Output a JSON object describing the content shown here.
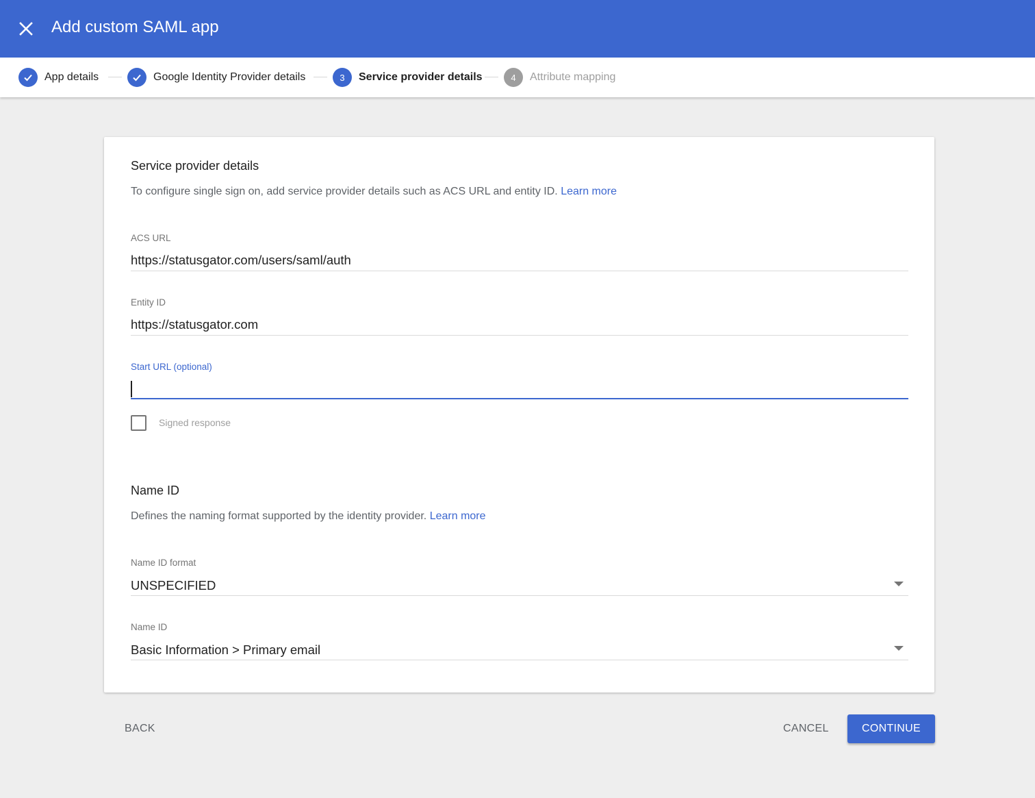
{
  "header": {
    "title": "Add custom SAML app",
    "close_icon": "close-icon"
  },
  "stepper": {
    "steps": [
      {
        "label": "App details",
        "state": "done",
        "number": "1"
      },
      {
        "label": "Google Identity Provider details",
        "state": "done",
        "number": "2"
      },
      {
        "label": "Service provider details",
        "state": "active",
        "number": "3"
      },
      {
        "label": "Attribute mapping",
        "state": "pending",
        "number": "4"
      }
    ]
  },
  "service_provider": {
    "title": "Service provider details",
    "description": "To configure single sign on, add service provider details such as ACS URL and entity ID.",
    "learn_more": "Learn more",
    "acs_url": {
      "label": "ACS URL",
      "value": "https://statusgator.com/users/saml/auth"
    },
    "entity_id": {
      "label": "Entity ID",
      "value": "https://statusgator.com"
    },
    "start_url": {
      "label": "Start URL (optional)",
      "value": ""
    },
    "signed_response": {
      "label": "Signed response",
      "checked": false
    }
  },
  "name_id": {
    "title": "Name ID",
    "description": "Defines the naming format supported by the identity provider.",
    "learn_more": "Learn more",
    "format": {
      "label": "Name ID format",
      "value": "UNSPECIFIED"
    },
    "name_id": {
      "label": "Name ID",
      "value": "Basic Information > Primary email"
    }
  },
  "footer": {
    "back": "BACK",
    "cancel": "CANCEL",
    "continue": "CONTINUE"
  },
  "colors": {
    "accent": "#3c67cf",
    "pending": "#9e9e9e",
    "background": "#eeeeee"
  }
}
